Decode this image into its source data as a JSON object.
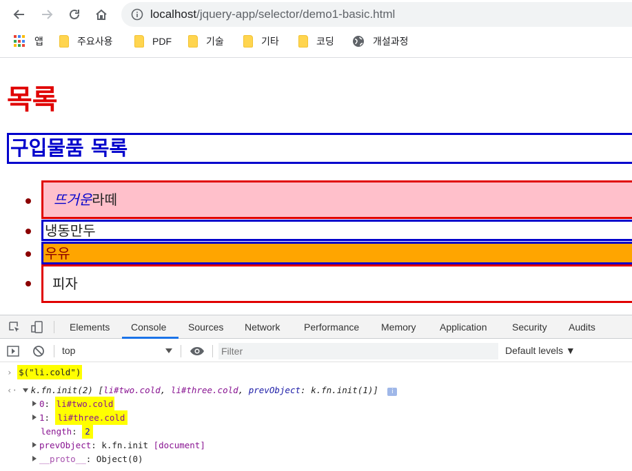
{
  "browser": {
    "url_host": "localhost",
    "url_path": "/jquery-app/selector/demo1-basic.html"
  },
  "bookmarks": [
    {
      "label": "앱",
      "icon": "apps-icon"
    },
    {
      "label": "주요사용",
      "icon": "folder-icon"
    },
    {
      "label": "PDF",
      "icon": "folder-icon"
    },
    {
      "label": "기술",
      "icon": "folder-icon"
    },
    {
      "label": "기타",
      "icon": "folder-icon"
    },
    {
      "label": "코딩",
      "icon": "folder-icon"
    },
    {
      "label": "개설과정",
      "icon": "globe-icon"
    }
  ],
  "page": {
    "title": "목록",
    "subtitle": "구입물품 목록",
    "items": [
      {
        "em": "뜨거운",
        "text": "라떼"
      },
      {
        "text": "냉동만두"
      },
      {
        "text": "우유"
      },
      {
        "text": "피자"
      }
    ]
  },
  "devtools": {
    "tabs": [
      "Elements",
      "Console",
      "Sources",
      "Network",
      "Performance",
      "Memory",
      "Application",
      "Security",
      "Audits"
    ],
    "active_tab": "Console",
    "context": "top",
    "filter_placeholder": "Filter",
    "levels": "Default levels ▼",
    "console": {
      "input": "$(\"li.cold\")",
      "result_head": "k.fn.init(2)",
      "result_preview_open": "[",
      "preview_item1": "li#two.cold",
      "preview_item2": "li#three.cold",
      "preview_prev_key": "prevObject",
      "preview_prev_val": "k.fn.init(1)",
      "preview_close": "]",
      "entry0_key": "0",
      "entry0_val": "li#two.cold",
      "entry1_key": "1",
      "entry1_val": "li#three.cold",
      "length_key": "length",
      "length_val": "2",
      "prev_key": "prevObject",
      "prev_val": "k.fn.init",
      "prev_doc": "[document]",
      "proto_key": "__proto__",
      "proto_val": "Object(0)"
    }
  },
  "colors": {
    "heading": "#e00000",
    "subheading": "#0000cc",
    "hot_bg": "#ffc0cb",
    "cold_bg": "#ffa500",
    "highlight": "#ffff00"
  }
}
